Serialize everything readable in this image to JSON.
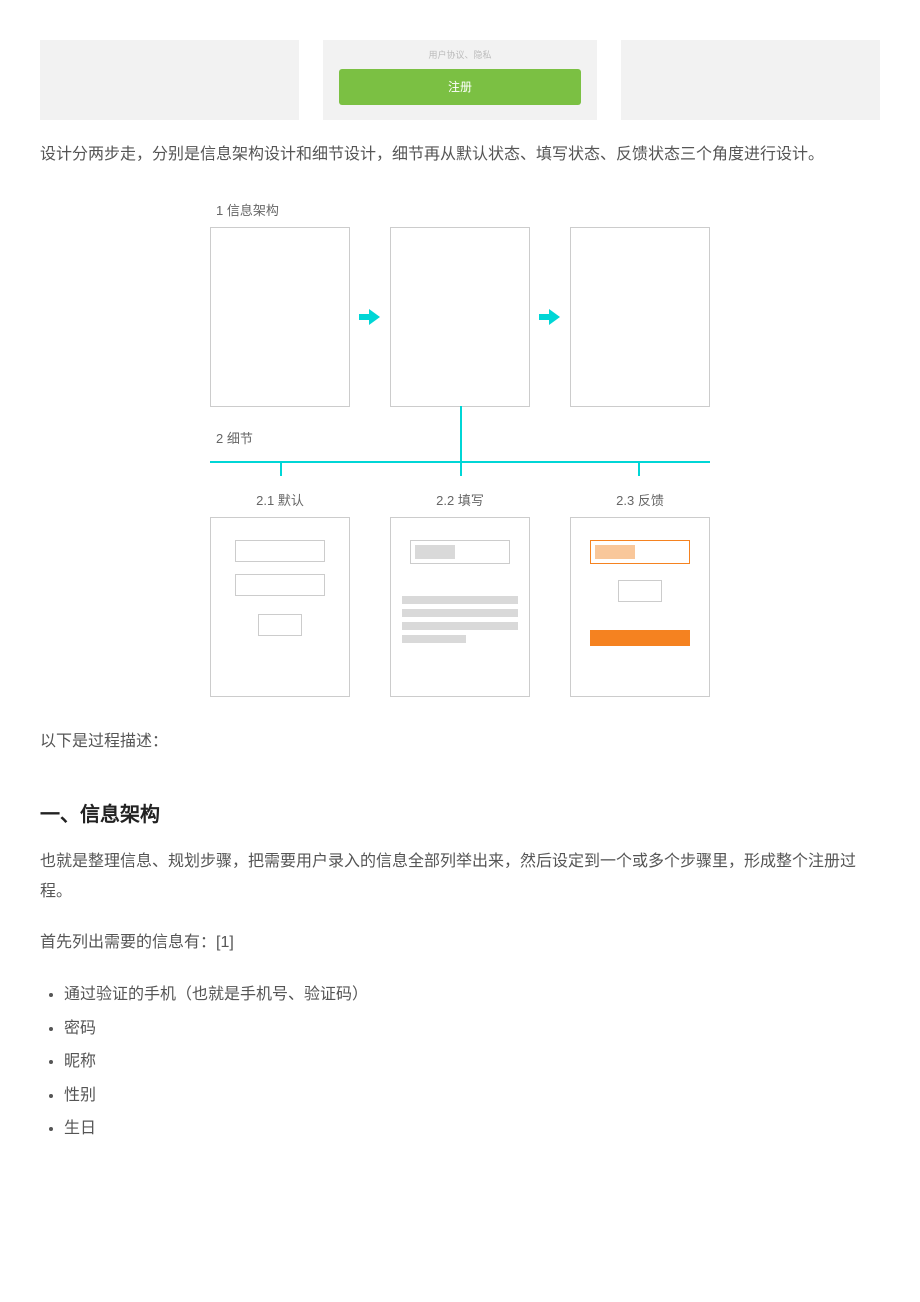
{
  "top": {
    "caption": "用户协议、隐私",
    "register_btn": "注册"
  },
  "paragraph_intro": "设计分两步走，分别是信息架构设计和细节设计，细节再从默认状态、填写状态、反馈状态三个角度进行设计。",
  "diagram": {
    "step1_label": "1 信息架构",
    "step2_label": "2 细节",
    "sub1": "2.1 默认",
    "sub2": "2.2 填写",
    "sub3": "2.3 反馈"
  },
  "paragraph_process": "以下是过程描述：",
  "heading_1": "一、信息架构",
  "paragraph_ia": "也就是整理信息、规划步骤，把需要用户录入的信息全部列举出来，然后设定到一个或多个步骤里，形成整个注册过程。",
  "paragraph_list_intro": "首先列出需要的信息有：[1]",
  "info_list": {
    "i0": "通过验证的手机（也就是手机号、验证码）",
    "i1": "密码",
    "i2": "昵称",
    "i3": "性别",
    "i4": "生日"
  }
}
